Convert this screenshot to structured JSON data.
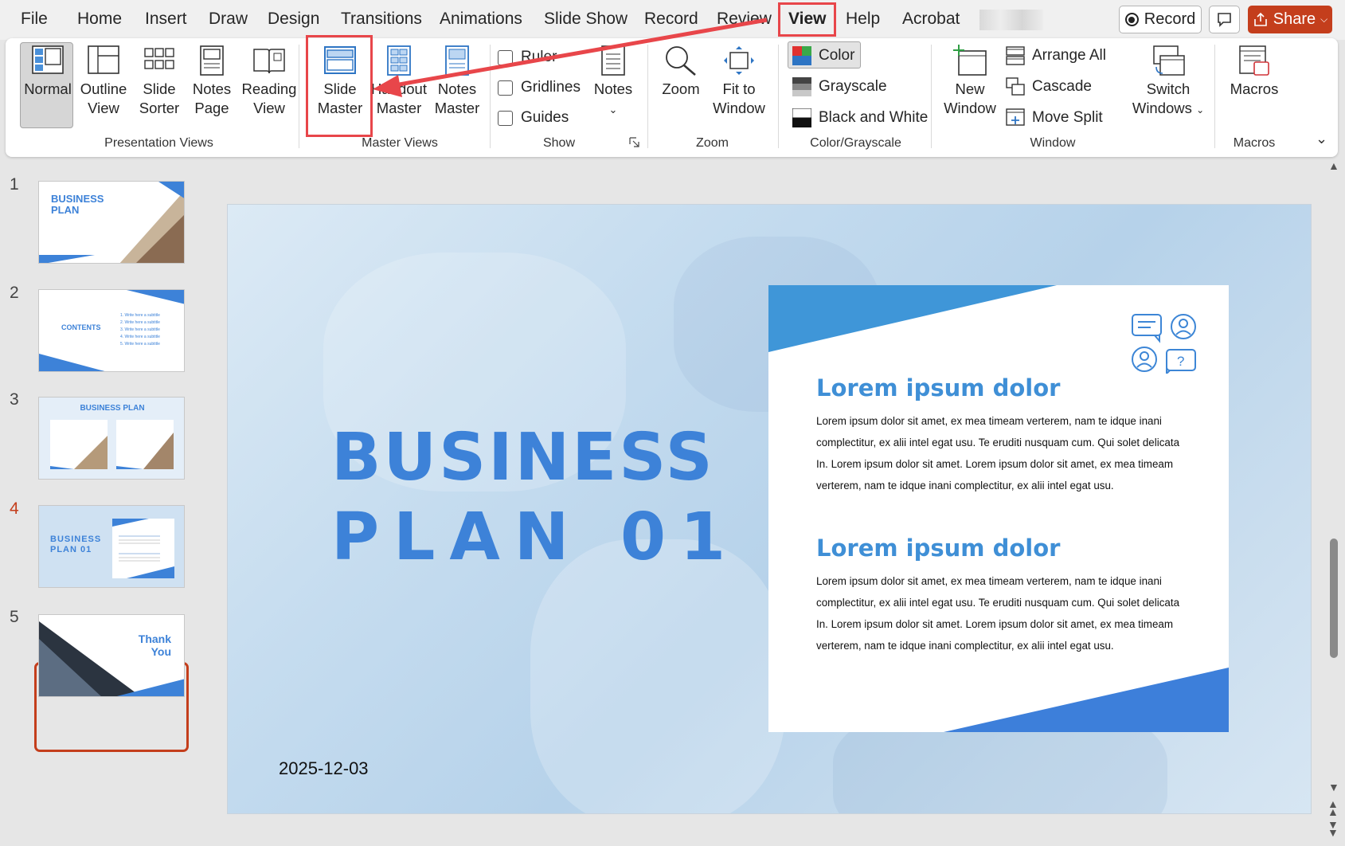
{
  "menu": {
    "tabs": [
      "File",
      "Home",
      "Insert",
      "Draw",
      "Design",
      "Transitions",
      "Animations",
      "Slide Show",
      "Record",
      "Review",
      "View",
      "Help",
      "Acrobat"
    ],
    "active_tab": "View",
    "record_label": "Record",
    "share_label": "Share"
  },
  "ribbon": {
    "presentation_views": {
      "label": "Presentation Views",
      "normal": "Normal",
      "outline": [
        "Outline",
        "View"
      ],
      "sorter": [
        "Slide",
        "Sorter"
      ],
      "notes_page": [
        "Notes",
        "Page"
      ],
      "reading": [
        "Reading",
        "View"
      ]
    },
    "master_views": {
      "label": "Master Views",
      "slide_master": [
        "Slide",
        "Master"
      ],
      "handout_master": [
        "Handout",
        "Master"
      ],
      "notes_master": [
        "Notes",
        "Master"
      ]
    },
    "show": {
      "label": "Show",
      "ruler": "Ruler",
      "gridlines": "Gridlines",
      "guides": "Guides",
      "notes": "Notes"
    },
    "zoom": {
      "label": "Zoom",
      "zoom": "Zoom",
      "fit": [
        "Fit to",
        "Window"
      ]
    },
    "color": {
      "label": "Color/Grayscale",
      "color": "Color",
      "grayscale": "Grayscale",
      "bw": "Black and White"
    },
    "window": {
      "label": "Window",
      "new_window": [
        "New",
        "Window"
      ],
      "arrange_all": "Arrange All",
      "cascade": "Cascade",
      "move_split": "Move Split",
      "switch": [
        "Switch",
        "Windows"
      ]
    },
    "macros": {
      "label": "Macros",
      "macros": "Macros"
    }
  },
  "thumbnails": {
    "numbers": [
      "1",
      "2",
      "3",
      "4",
      "5"
    ],
    "active": "4",
    "t1": [
      "BUSINESS",
      "PLAN"
    ],
    "t2": "CONTENTS",
    "t2_items": [
      "1. Write here a subtitle",
      "2. Write here a subtitle",
      "3. Write here a subtitle",
      "4. Write here a subtitle",
      "5. Write here a subtitle"
    ],
    "t3": "BUSINESS PLAN",
    "t4": [
      "BUSINESS",
      "PLAN  01"
    ],
    "t5": [
      "Thank",
      "You"
    ]
  },
  "slide": {
    "title_line1": "BUSINESS",
    "title_line2": "PLAN  01",
    "date": "2025-12-03",
    "heading1": "Lorem ipsum dolor",
    "body1": "Lorem ipsum dolor sit amet, ex mea timeam verterem, nam te idque inani complectitur, ex alii intel egat usu. Te eruditi nusquam cum. Qui solet delicata In. Lorem ipsum dolor sit amet. Lorem ipsum dolor sit amet, ex mea timeam verterem, nam te idque inani complectitur, ex alii intel egat usu.",
    "heading2": "Lorem ipsum dolor",
    "body2": "Lorem ipsum dolor sit amet, ex mea timeam verterem, nam te idque inani complectitur, ex alii intel egat usu. Te eruditi nusquam cum. Qui solet delicata In. Lorem ipsum dolor sit amet. Lorem ipsum dolor sit amet, ex mea timeam verterem, nam te idque inani complectitur, ex alii intel egat usu."
  },
  "colors": {
    "accent": "#c43e1c",
    "highlight": "#e8464a",
    "slide_blue": "#3d82d8"
  }
}
